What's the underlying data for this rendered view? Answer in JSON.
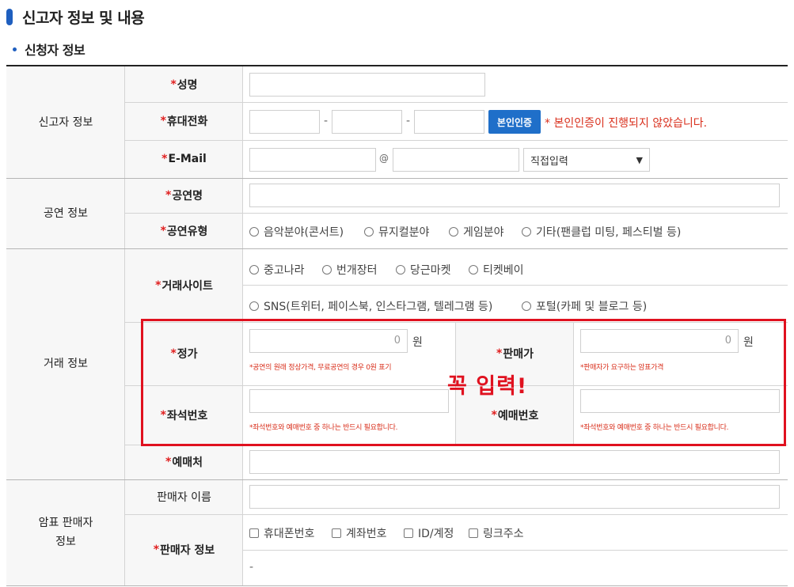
{
  "header": {
    "title": "신고자 정보 및 내용"
  },
  "section": {
    "title": "신청자 정보"
  },
  "groups": {
    "reporter": "신고자 정보",
    "performance": "공연 정보",
    "trade": "거래 정보",
    "seller_line1": "암표 판매자",
    "seller_line2": "정보"
  },
  "required_mark": "*",
  "labels": {
    "name": "성명",
    "phone": "휴대전화",
    "email": "E-Mail",
    "perf_name": "공연명",
    "perf_type": "공연유형",
    "trade_site": "거래사이트",
    "list_price": "정가",
    "sale_price": "판매가",
    "seat_no": "좌석번호",
    "reservation_no": "예매번호",
    "ticket_office": "예매처",
    "seller_name": "판매자 이름",
    "seller_info": "판매자 정보"
  },
  "phone": {
    "separator": "-",
    "verify_button": "본인인증",
    "not_verified_note": "* 본인인증이 진행되지 않았습니다."
  },
  "email": {
    "at": "@",
    "domain_select": "직접입력"
  },
  "perf_types": [
    "음악분야(콘서트)",
    "뮤지컬분야",
    "게임분야",
    "기타(팬클럽 미팅, 페스티벌 등)"
  ],
  "trade_sites_row1": [
    "중고나라",
    "번개장터",
    "당근마켓",
    "티켓베이"
  ],
  "trade_sites_row2": [
    "SNS(트위터, 페이스북, 인스타그램, 텔레그램 등)",
    "포털(카페 및 블로그 등)"
  ],
  "prices": {
    "list_price_value": "0",
    "sale_price_value": "0",
    "unit": "원",
    "list_hint": "*공연의 원래 정상가격, 무료공연의 경우 0원 표기",
    "sale_hint": "*판매자가 요구하는 암표가격"
  },
  "seat_hint": "*좌석번호와 예매번호 중 하나는 반드시 필요합니다.",
  "reservation_hint": "*좌석번호와 예매번호 중 하나는 반드시 필요합니다.",
  "annotation": "꼭 입력!",
  "seller_info_options": [
    "휴대폰번호",
    "계좌번호",
    "ID/계정",
    "링크주소"
  ],
  "seller_info_value": "-",
  "colors": {
    "accent": "#1f5fbf",
    "button": "#1f6fc9",
    "required": "#e02020",
    "highlight": "#e0111f"
  }
}
